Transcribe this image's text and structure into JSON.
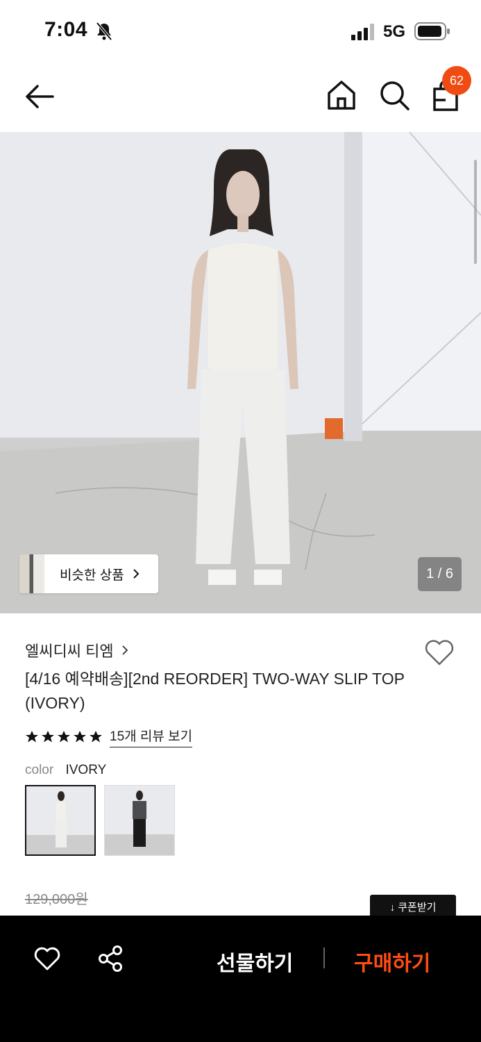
{
  "status_bar": {
    "time": "7:04",
    "network": "5G"
  },
  "header": {
    "cart_count": "62"
  },
  "hero": {
    "similar_label": "비슷한 상품",
    "counter": "1 / 6"
  },
  "product": {
    "brand": "엘씨디씨 티엠",
    "title": "[4/16 예약배송][2nd REORDER] TWO-WAY SLIP TOP (IVORY)",
    "rating_stars": 5,
    "review_link": "15개 리뷰 보기",
    "color_key": "color",
    "color_value": "IVORY",
    "original_price": "129,000원",
    "coupon_label": "↓ 쿠폰받기"
  },
  "bottom_bar": {
    "gift_label": "선물하기",
    "buy_label": "구매하기"
  },
  "colors": {
    "accent": "#f04b12",
    "buy": "#ff4d12",
    "bar": "#000000"
  }
}
